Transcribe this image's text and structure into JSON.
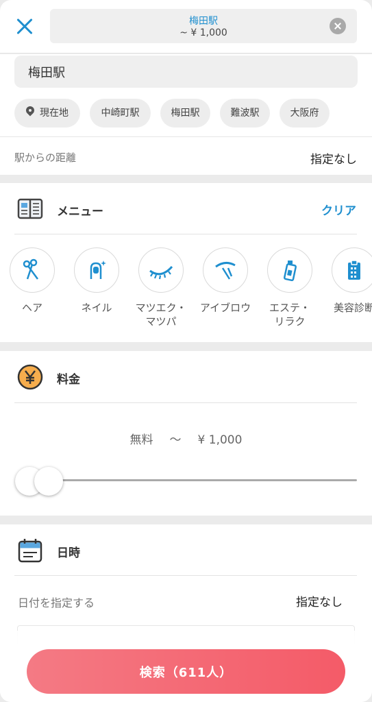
{
  "header": {
    "station": "梅田駅",
    "price_range": "~ ¥ 1,000"
  },
  "location": {
    "input_value": "梅田駅",
    "chips": [
      "現在地",
      "中崎町駅",
      "梅田駅",
      "難波駅",
      "大阪府"
    ],
    "distance_label": "駅からの距離",
    "distance_value": "指定なし"
  },
  "menu": {
    "title": "メニュー",
    "clear_label": "クリア",
    "categories": [
      {
        "label": "ヘア",
        "icon": "scissors-icon"
      },
      {
        "label": "ネイル",
        "icon": "nail-icon"
      },
      {
        "label": "マツエク・\nマツパ",
        "icon": "eyelash-icon"
      },
      {
        "label": "アイブロウ",
        "icon": "eyebrow-icon"
      },
      {
        "label": "エステ・\nリラク",
        "icon": "spray-bottle-icon"
      },
      {
        "label": "美容診断",
        "icon": "clipboard-icon"
      }
    ]
  },
  "price": {
    "title": "料金",
    "min_label": "無料",
    "separator": "～",
    "max_label": "¥ 1,000",
    "slider_min": 0,
    "slider_max": 0
  },
  "datetime": {
    "title": "日時",
    "date_label": "日付を指定する",
    "date_value": "指定なし"
  },
  "search_button": "検索（611人）",
  "colors": {
    "accent_blue": "#1f8fcf",
    "search_button": "#f45b68",
    "yen_icon": "#f6ad4d"
  }
}
